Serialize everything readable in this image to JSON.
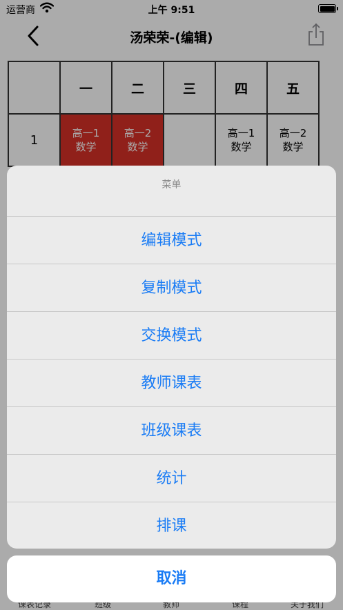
{
  "status_bar": {
    "carrier": "运营商",
    "time": "上午 9:51"
  },
  "nav": {
    "title": "汤荣荣-(编辑)",
    "back_icon": "chevron-left-icon",
    "share_icon": "share-icon"
  },
  "timetable": {
    "headers": [
      "",
      "一",
      "二",
      "三",
      "四",
      "五"
    ],
    "rows": [
      {
        "period": "1",
        "cells": [
          {
            "class": "高一1",
            "subject": "数学",
            "highlight": true
          },
          {
            "class": "高一2",
            "subject": "数学",
            "highlight": true
          },
          {
            "class": "",
            "subject": "",
            "highlight": false
          },
          {
            "class": "高一1",
            "subject": "数学",
            "highlight": false
          },
          {
            "class": "高一2",
            "subject": "数学",
            "highlight": false
          }
        ]
      }
    ],
    "highlight_color": "#d73128"
  },
  "tabbar": {
    "items": [
      "课表记录",
      "班级",
      "教师",
      "课程",
      "关于我们"
    ]
  },
  "action_sheet": {
    "title": "菜单",
    "options": [
      "编辑模式",
      "复制模式",
      "交换模式",
      "教师课表",
      "班级课表",
      "统计",
      "排课"
    ],
    "cancel": "取消",
    "accent_color": "#1a7cf5"
  }
}
